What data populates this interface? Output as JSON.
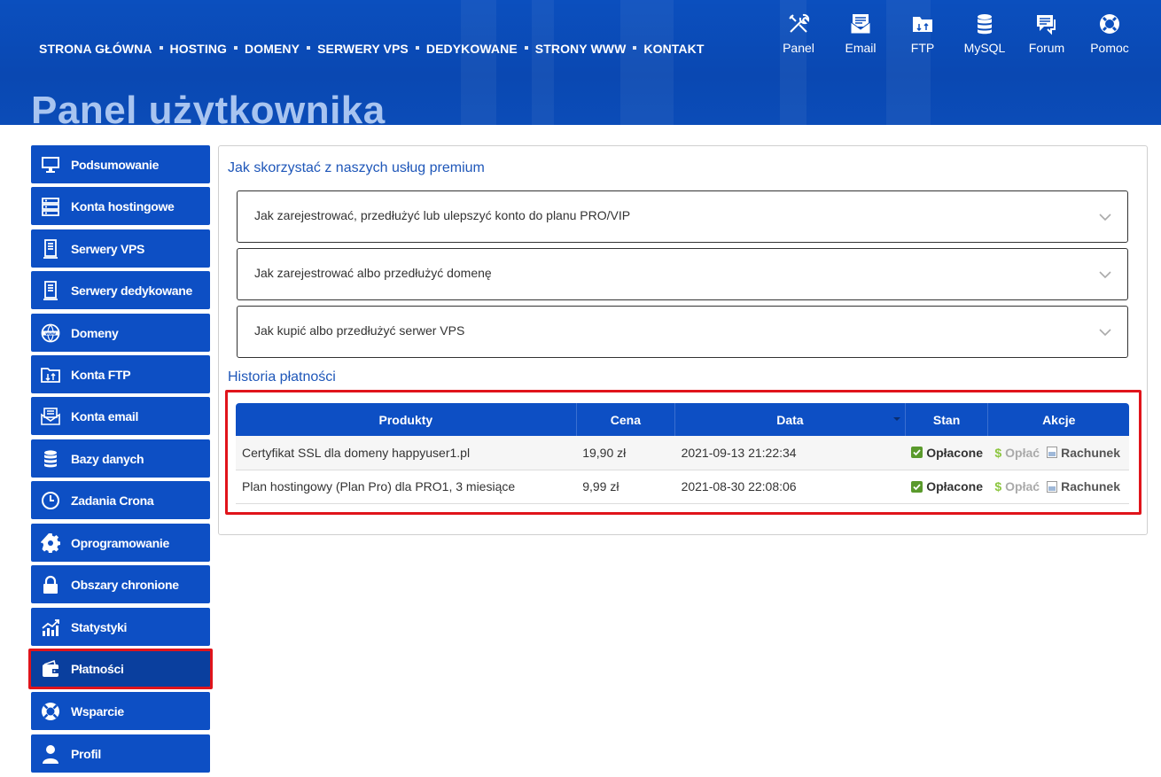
{
  "nav": {
    "items": [
      "STRONA GŁÓWNA",
      "HOSTING",
      "DOMENY",
      "SERWERY VPS",
      "DEDYKOWANE",
      "STRONY WWW",
      "KONTAKT"
    ]
  },
  "quick_links": [
    {
      "label": "Panel",
      "icon": "tools-icon"
    },
    {
      "label": "Email",
      "icon": "email-icon"
    },
    {
      "label": "FTP",
      "icon": "ftp-folder-icon"
    },
    {
      "label": "MySQL",
      "icon": "database-icon"
    },
    {
      "label": "Forum",
      "icon": "forum-icon"
    },
    {
      "label": "Pomoc",
      "icon": "lifebuoy-icon"
    }
  ],
  "page_title": "Panel użytkownika",
  "sidebar": {
    "items": [
      {
        "label": "Podsumowanie",
        "icon": "monitor-icon"
      },
      {
        "label": "Konta hostingowe",
        "icon": "server-icon"
      },
      {
        "label": "Serwery VPS",
        "icon": "tower-server-icon"
      },
      {
        "label": "Serwery dedykowane",
        "icon": "tower-server-icon"
      },
      {
        "label": "Domeny",
        "icon": "globe-www-icon"
      },
      {
        "label": "Konta FTP",
        "icon": "ftp-folder-icon"
      },
      {
        "label": "Konta email",
        "icon": "email-icon"
      },
      {
        "label": "Bazy danych",
        "icon": "database-icon"
      },
      {
        "label": "Zadania Crona",
        "icon": "clock-icon"
      },
      {
        "label": "Oprogramowanie",
        "icon": "gear-icon"
      },
      {
        "label": "Obszary chronione",
        "icon": "lock-icon"
      },
      {
        "label": "Statystyki",
        "icon": "chart-icon"
      },
      {
        "label": "Płatności",
        "icon": "wallet-icon"
      },
      {
        "label": "Wsparcie",
        "icon": "lifebuoy-icon"
      },
      {
        "label": "Profil",
        "icon": "user-icon"
      }
    ],
    "active": "Płatności"
  },
  "premium": {
    "title": "Jak skorzystać z naszych usług premium",
    "accordion": [
      "Jak zarejestrować, przedłużyć lub ulepszyć konto do planu PRO/VIP",
      "Jak zarejestrować albo przedłużyć domenę",
      "Jak kupić albo przedłużyć serwer VPS"
    ]
  },
  "history": {
    "title": "Historia płatności",
    "columns": [
      "Produkty",
      "Cena",
      "Data",
      "Stan",
      "Akcje"
    ],
    "rows": [
      {
        "product": "Certyfikat SSL dla domeny happyuser1.pl",
        "price": "19,90 zł",
        "date": "2021-09-13 21:22:34",
        "status": "Opłacone",
        "pay": "Opłać",
        "invoice": "Rachunek"
      },
      {
        "product": "Plan hostingowy (Plan Pro) dla PRO1, 3 miesiące",
        "price": "9,99 zł",
        "date": "2021-08-30 22:08:06",
        "status": "Opłacone",
        "pay": "Opłać",
        "invoice": "Rachunek"
      }
    ]
  },
  "colors": {
    "brand_blue": "#0d4fc4",
    "active_blue": "#0a3f9e",
    "highlight_red": "#e0141b",
    "title_blue": "#1f57b9",
    "paid_green": "#8cc63f"
  }
}
